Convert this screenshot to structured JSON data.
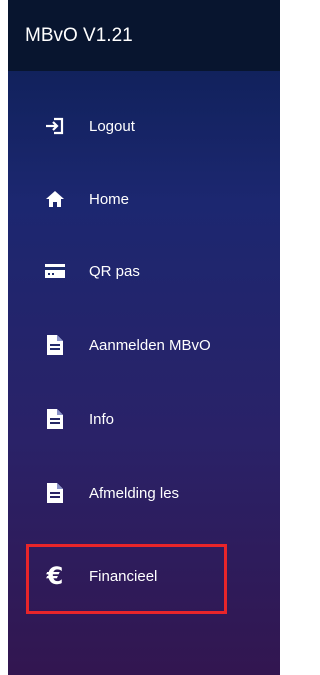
{
  "app": {
    "title": "MBvO V1.21"
  },
  "nav": {
    "items": [
      {
        "label": "Logout",
        "icon": "logout-icon"
      },
      {
        "label": "Home",
        "icon": "home-icon"
      },
      {
        "label": "QR pas",
        "icon": "card-icon"
      },
      {
        "label": "Aanmelden MBvO",
        "icon": "document-icon"
      },
      {
        "label": "Info",
        "icon": "document-icon"
      },
      {
        "label": "Afmelding les",
        "icon": "document-icon"
      },
      {
        "label": "Financieel",
        "icon": "euro-icon",
        "highlighted": true
      }
    ]
  },
  "colors": {
    "topbar": "#08152f",
    "gradient_top": "#0b1f52",
    "gradient_bottom": "#321650",
    "highlight": "#e8252a"
  }
}
